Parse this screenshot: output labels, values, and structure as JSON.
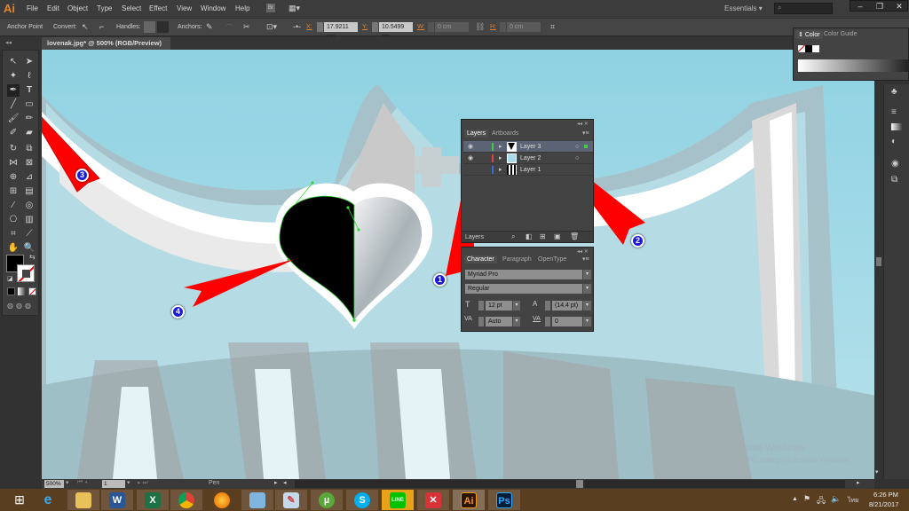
{
  "app": {
    "logo": "Ai",
    "name": "Adobe Illustrator"
  },
  "menu": [
    "File",
    "Edit",
    "Object",
    "Type",
    "Select",
    "Effect",
    "View",
    "Window",
    "Help"
  ],
  "menu_extra": {
    "bridge": "Br",
    "workspace": "Essentials",
    "search_placeholder": ""
  },
  "window_controls": {
    "minimize": "–",
    "restore": "❐",
    "close": "✕"
  },
  "control_bar": {
    "mode_label": "Anchor Point",
    "convert_label": "Convert:",
    "handles_label": "Handles:",
    "anchors_label": "Anchors:",
    "x_label": "X:",
    "x_value": "17.9211 cm",
    "y_label": "Y:",
    "y_value": "10.5499 cm",
    "w_label": "W:",
    "w_value": "0 cm",
    "h_label": "H:",
    "h_value": "0 cm"
  },
  "document": {
    "tab_title": "lovenak.jpg* @ 500% (RGB/Preview)",
    "close": "×"
  },
  "tools": {
    "active": "pen-tool",
    "fill_color": "#000000",
    "stroke": "none"
  },
  "layers_panel": {
    "tabs": [
      "Layers",
      "Artboards"
    ],
    "active_tab": "Layers",
    "layers": [
      {
        "name": "Layer 3",
        "color": "#3ecf3e",
        "visible": true,
        "selected": true
      },
      {
        "name": "Layer 2",
        "color": "#e04040",
        "visible": true,
        "selected": false
      },
      {
        "name": "Layer 1",
        "color": "#3a6de0",
        "visible": false,
        "selected": false
      }
    ],
    "footer_label": "Layers"
  },
  "character_panel": {
    "tabs": [
      "Character",
      "Paragraph",
      "OpenType"
    ],
    "active_tab": "Character",
    "font_family": "Myriad Pro",
    "font_style": "Regular",
    "font_size": "12 pt",
    "leading": "(14.4 pt)",
    "kerning": "Auto",
    "tracking": "0"
  },
  "color_panel": {
    "tabs": [
      "Color",
      "Color Guide"
    ],
    "active_tab": "Color"
  },
  "status_bar": {
    "zoom": "500%",
    "artboard": "1",
    "tool": "Pen"
  },
  "annotations": [
    {
      "number": "1",
      "points_to": "Layers panel"
    },
    {
      "number": "2",
      "points_to": "Layer 3 row"
    },
    {
      "number": "3",
      "points_to": "Pen tool"
    },
    {
      "number": "4",
      "points_to": "Black half-heart path"
    }
  ],
  "watermark": {
    "line1": "Activate Windows",
    "line2": "Go to PC settings to activate Windows."
  },
  "taskbar": {
    "apps": [
      "Internet Explorer",
      "File Explorer",
      "Word",
      "Excel",
      "Chrome",
      "Firefox",
      "Notepad",
      "Paint",
      "uTorrent",
      "Skype",
      "LINE",
      "Acrobat",
      "Illustrator",
      "Photoshop"
    ],
    "time": "6:26 PM",
    "date": "8/21/2017",
    "lang": "ไทย"
  }
}
